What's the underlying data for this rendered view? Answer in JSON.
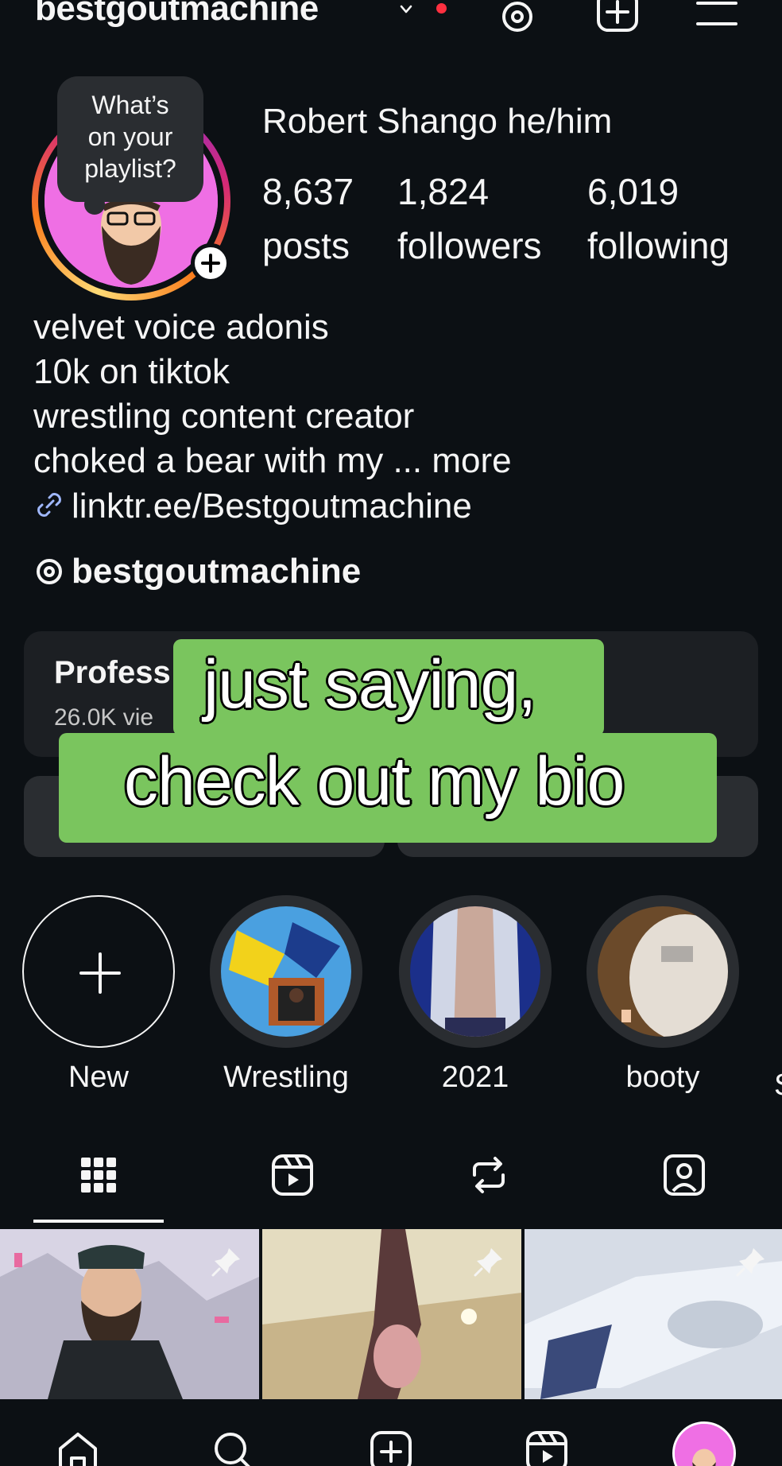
{
  "header": {
    "username": "bestgoutmachine",
    "notification_dot_color": "#ff3040",
    "icons": [
      "threads-icon",
      "create-plus-icon",
      "menu-icon"
    ]
  },
  "profile": {
    "note_text": "What’s\non your\nplaylist?",
    "full_name": "Robert Shango he/him",
    "stats": {
      "posts_count": "8,637",
      "posts_label": "posts",
      "followers_count": "1,824",
      "followers_label": "followers",
      "following_count": "6,019",
      "following_label": "following"
    },
    "bio_lines": [
      "velvet voice adonis",
      "10k on tiktok",
      "wrestling content creator",
      "choked a bear with my ... more"
    ],
    "link": "linktr.ee/Bestgoutmachine",
    "threads_handle": "bestgoutmachine"
  },
  "dashboard": {
    "title": "Profess",
    "subtitle": "26.0K vie"
  },
  "caption": {
    "line1": "just saying,",
    "line2": "check out my bio",
    "bg_color": "#7ac55e"
  },
  "highlights": [
    {
      "label": "New"
    },
    {
      "label": "Wrestling"
    },
    {
      "label": "2021"
    },
    {
      "label": "booty"
    }
  ],
  "highlight_edge_text": "S",
  "tabs": [
    "grid-icon",
    "reels-icon",
    "reposts-icon",
    "tagged-icon"
  ],
  "bottom_nav": [
    "home-icon",
    "search-icon",
    "create-icon",
    "reels-icon",
    "profile-avatar"
  ],
  "colors": {
    "background": "#0c1014",
    "surface": "#1c1f23",
    "text": "#f5f5f5",
    "link_icon": "#a0b8ff"
  }
}
